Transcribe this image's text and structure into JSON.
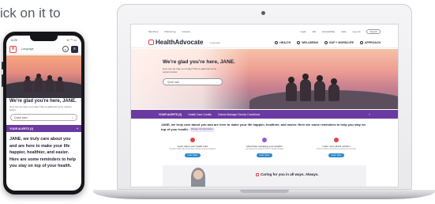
{
  "caption": "ick on it to",
  "phone": {
    "time": "4:29",
    "status_icons": "▪▪ ◠ ▭",
    "logo_letter": "H",
    "language": "Language",
    "search_icon": "search-icon",
    "menu_icon": "menu-icon",
    "welcome": "We're glad you're here, JANE.",
    "subtitle": "How can we help you today? We've gathered some options below.",
    "select_placeholder": "Quick start",
    "alerts_label": "YOUR ALERTS (2)",
    "alerts_plus": "+",
    "body_text": "JANE, we truly care about you and are here to make your life happier, healthier, and easier. Here are some reminders to help you stay on top of your health."
  },
  "laptop": {
    "util_links": [
      "Members",
      "Partnering",
      "Careers"
    ],
    "util_right": [
      "Login",
      "EN",
      "Accessibility",
      "Help",
      "Log out"
    ],
    "util_search": "Search",
    "logo_text": "HealthAdvocate",
    "logo_lang": "Language",
    "nav_items": [
      "HEALTH",
      "WELLBEING",
      "EAP + WORK/LIFE",
      "APPROACH"
    ],
    "welcome": "We're glad you're here, JANE.",
    "subtitle": "How can we help you today? We've gathered some options below.",
    "select_placeholder": "Quick start",
    "alerts": {
      "title": "YOUR ALERTS (2)",
      "item1": "Health Care Credits",
      "item2": "Claims Manage Chronic Conditions",
      "plus": "+"
    },
    "intro": "JANE, we truly care about you and are here to make your life happier, healthier, and easier. Here are some reminders to help you stay on top of your health.",
    "intro_pill": "Manage Your Reminders",
    "cards": [
      {
        "title": "Learn about your health risks",
        "sub": "Identify health risks before they become serious problems",
        "button": "Learn More",
        "color": "#e0454a"
      },
      {
        "title": "Need help managing your weight?",
        "sub": "Get started on a plan to reach a healthy weight",
        "button": "Learn More",
        "color": "#9a5bd0"
      },
      {
        "title": "Learn more about nutrition",
        "sub": "Find out what to eat to keep yourself at your best",
        "button": "Learn More",
        "color": "#e0454a"
      }
    ],
    "care_text": "Caring for you in all ways. Always."
  }
}
